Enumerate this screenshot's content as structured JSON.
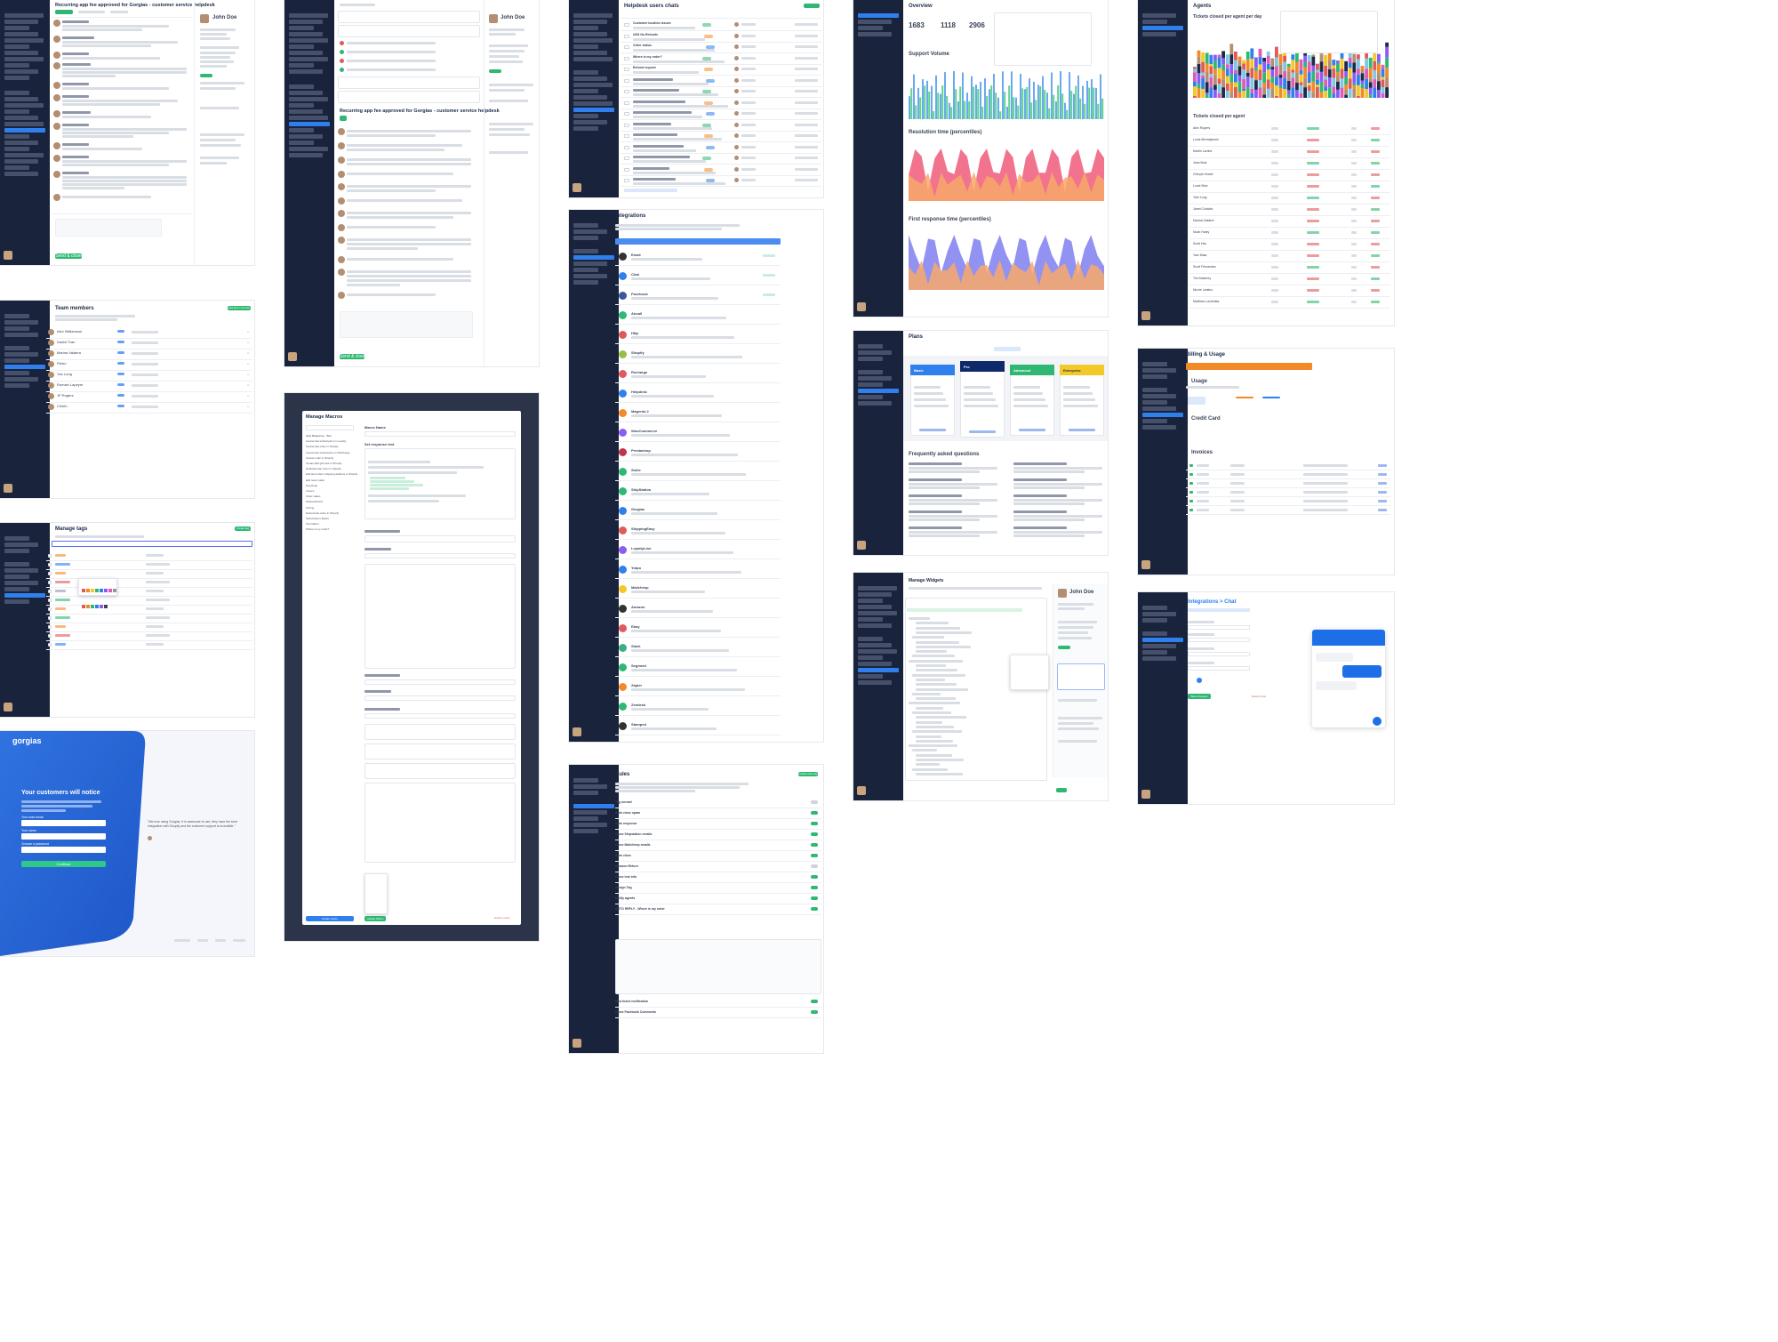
{
  "ticket_a": {
    "title": "Recurring app fee approved for Gorgias - customer service helpdesk",
    "customer": "John Doe",
    "send_label": "Send & close"
  },
  "ticket_b": {
    "title": "Recurring app fee approved for Gorgias - customer service helpdesk",
    "customer": "John Doe",
    "send_label": "Send & close"
  },
  "team": {
    "title": "Team members",
    "add_label": "Add team member",
    "members": [
      "Alex Williamson",
      "Daniel Tran",
      "Marina Valdera",
      "Pietro",
      "Yan Long",
      "Romain Lapeyre",
      "JP Rogers",
      "Chinfo"
    ]
  },
  "tags": {
    "title": "Manage tags",
    "create_label": "Create tag"
  },
  "login": {
    "brand": "gorgias",
    "heading": "Your customers will notice",
    "field_email": "Your work email",
    "field_name": "Your name",
    "field_password": "Choose a password",
    "continue_label": "Continue",
    "quote": "\"We love using Gorgias. It is awesome to use, they have the best integration with Shopify and the customer support is incredible.\""
  },
  "macros": {
    "title": "Manage Macros",
    "macro_name_label": "Macro Name",
    "response_label": "Set response text",
    "create_label": "Create macro",
    "update_label": "Update Macro",
    "delete_label": "Delete macro",
    "list": [
      "Auto Response - Test",
      "Cancel last subscription in Loyalty",
      "Cancel last order in Shopify",
      "Cancel last subscription in ReCharge",
      "Cancel order in Shopify",
      "Create $10 gift card in Shopify",
      "Duplicate last order in Shopify",
      "Edit last order's shipping address in Shopify",
      "Edit return label",
      "Greetings",
      "Invoice",
      "Order status",
      "Partial Refund",
      "Pricing",
      "Refund last order in Shopify",
      "Subscription Status",
      "Test Macro",
      "Where is my order?"
    ]
  },
  "users_chats": {
    "title": "Helpdesk users chats",
    "tickets": [
      "Customer location issues",
      "UDS No Refunds",
      "Order status",
      "Where is my order?",
      "Refund request"
    ]
  },
  "integrations": {
    "title": "Integrations",
    "items": [
      "Email",
      "Chat",
      "Facebook",
      "Aircall",
      "Http",
      "Shopify",
      "Recharge",
      "Helpdesk",
      "Magento 2",
      "WooCommerce",
      "Prestashop",
      "Smile",
      "ShipStation",
      "Gorgias",
      "ShippingEasy",
      "LoyaltyLion",
      "Yotpo",
      "Mailchimp",
      "Amazon",
      "Ebay",
      "Slack",
      "Segment",
      "Zapier",
      "Zendesk",
      "Stamped"
    ]
  },
  "rules": {
    "title": "Rules",
    "create_label": "Create new rule",
    "items": [
      "Tag unread",
      "Auto close spam",
      "Auto response",
      "Close Shipstation emails",
      "Close Mailchimp emails",
      "Auto close",
      "Amazon Return",
      "Close lost info",
      "Assign Tag",
      "Notify agents",
      "AUTO REPLY - Where is my order",
      "New ticket notification",
      "Close Facebook Comments"
    ]
  },
  "statistics": {
    "title": "Overview",
    "new_tickets": "1683",
    "closed_tickets": "1118",
    "messages_sent": "2906",
    "charts": [
      "Support Volume",
      "Resolution time (percentiles)",
      "First response time (percentiles)"
    ]
  },
  "plans": {
    "title": "Plans",
    "items": [
      "Basic",
      "Pro",
      "Advanced",
      "Enterprise"
    ],
    "faq_title": "Frequently asked questions"
  },
  "widgets": {
    "title": "Manage Widgets",
    "customer": "John Doe"
  },
  "agents": {
    "title": "Agents",
    "chart_title": "Tickets closed per agent per day",
    "table_title": "Tickets closed per agent",
    "agents": [
      "Alex Rogers",
      "Louis Bermejavelo",
      "Martin Lambe",
      "Jean Bois",
      "Chinyle Kester",
      "Louie Bloe",
      "Yani Long",
      "Janet Colavita",
      "Marina Valdera",
      "Noah Haley",
      "Scott Hsu",
      "Yani Maia",
      "Scott Fernandes",
      "Tim Masbrey",
      "Nicole Lantino",
      "Matthew Lavirtotka"
    ]
  },
  "billing": {
    "title": "Billing & Usage",
    "usage_label": "Usage",
    "credit_card_label": "Credit Card",
    "invoices_label": "Invoices"
  },
  "chat": {
    "title": "Integrations > Chat",
    "save_label": "Save changes",
    "delete_label": "Delete Chat"
  }
}
